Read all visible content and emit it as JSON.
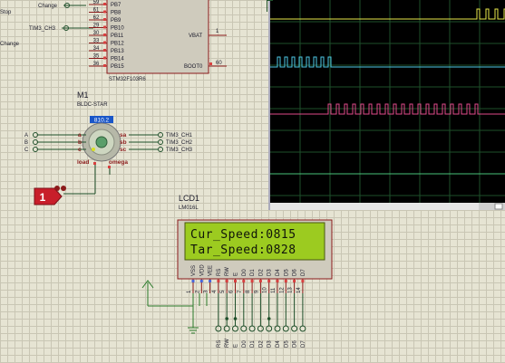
{
  "labels": {
    "stop": "Stop",
    "change_top": "Change",
    "change_left": "Change",
    "tim3_ch3_net": "TIM3_CH3"
  },
  "mcu": {
    "name": "STM32F103R6",
    "pins_left": [
      {
        "num": "59",
        "name": "PB7"
      },
      {
        "num": "61",
        "name": "PB8"
      },
      {
        "num": "62",
        "name": "PB9"
      },
      {
        "num": "29",
        "name": "PB10"
      },
      {
        "num": "30",
        "name": "PB11"
      },
      {
        "num": "33",
        "name": "PB12"
      },
      {
        "num": "34",
        "name": "PB13"
      },
      {
        "num": "35",
        "name": "PB14"
      },
      {
        "num": "36",
        "name": "PB15"
      }
    ],
    "vbat": {
      "name": "VBAT",
      "num": "1"
    },
    "boot0": {
      "name": "BOOT0",
      "num": "60"
    }
  },
  "motor": {
    "ref": "M1",
    "type": "BLDC-STAR",
    "speed_readout": "810.2",
    "pins_left": [
      "A",
      "B",
      "C"
    ],
    "coil_left": [
      "a",
      "b",
      "c"
    ],
    "coil_right": [
      "sa",
      "sb",
      "sc"
    ],
    "load": "load",
    "omega": "omega",
    "outputs": [
      "TIM3_CH1",
      "TIM3_CH2",
      "TIM3_CH3"
    ]
  },
  "source": {
    "value": "1"
  },
  "lcd": {
    "ref": "LCD1",
    "model": "LM016L",
    "line1": "Cur_Speed:0815",
    "line2": "Tar_Speed:0828",
    "pin_names": [
      "VSS",
      "VDD",
      "VEE",
      "RS",
      "RW",
      "E",
      "D0",
      "D1",
      "D2",
      "D3",
      "D4",
      "D5",
      "D6",
      "D7"
    ],
    "pin_nums": [
      "1",
      "2",
      "3",
      "4",
      "5",
      "6",
      "7",
      "8",
      "9",
      "10",
      "11",
      "12",
      "13",
      "14"
    ],
    "probes": [
      "RS",
      "RW",
      "E",
      "D0",
      "D1",
      "D2",
      "D3",
      "D4",
      "D5",
      "D6",
      "D7"
    ]
  },
  "scope": {
    "bg": "#000000",
    "traces": [
      {
        "color": "#e8e84a"
      },
      {
        "color": "#4ec8e6"
      },
      {
        "color": "#e04a8a"
      },
      {
        "color": "#49c27a"
      }
    ]
  },
  "colors": {
    "wire": "#1e4f2a",
    "component": "#8b1a1a",
    "body": "#cfcbbd",
    "lcd_screen": "#9ccb20",
    "ground": "#2a7a2a"
  }
}
